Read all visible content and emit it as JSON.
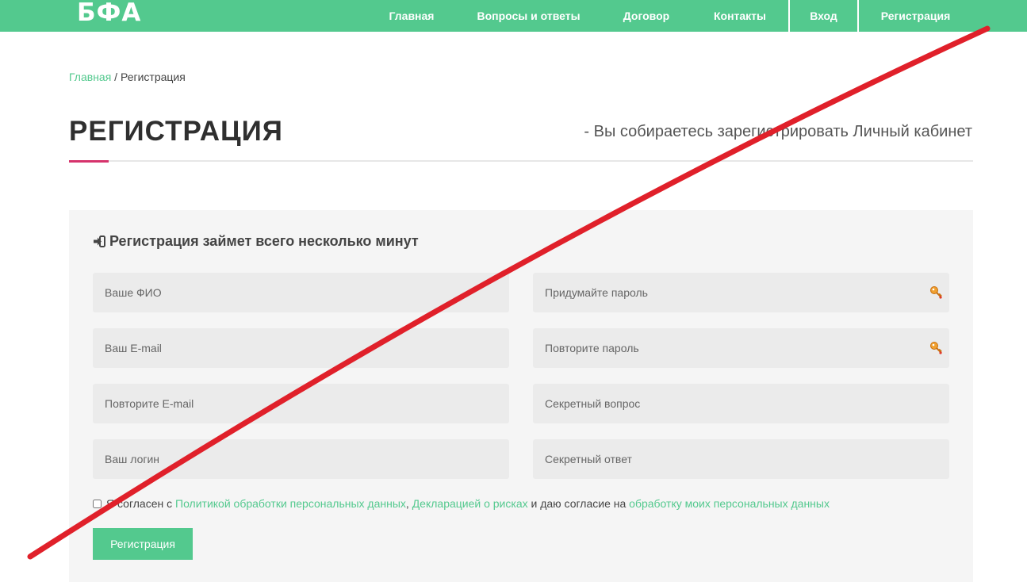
{
  "header": {
    "logo": "БФА",
    "nav": [
      {
        "label": "Главная"
      },
      {
        "label": "Вопросы и ответы"
      },
      {
        "label": "Договор"
      },
      {
        "label": "Контакты"
      },
      {
        "label": "Вход"
      },
      {
        "label": "Регистрация"
      }
    ],
    "background": "#53c98e"
  },
  "breadcrumb": {
    "home": "Главная",
    "separator": " / ",
    "current": "Регистрация"
  },
  "page": {
    "title": "РЕГИСТРАЦИЯ",
    "subtitle": "- Вы собираетесь зарегистрировать Личный кабинет",
    "accent_color": "#d6336c"
  },
  "form": {
    "heading": "Регистрация займет всего несколько минут",
    "fields": {
      "full_name": "Ваше ФИО",
      "email": "Ваш E-mail",
      "email_repeat": "Повторите E-mail",
      "login": "Ваш логин",
      "password": "Придумайте пароль",
      "password_repeat": "Повторите пароль",
      "secret_question": "Секретный вопрос",
      "secret_answer": "Секретный ответ"
    },
    "consent": {
      "prefix": "Я согласен с ",
      "link_policy": "Политикой обработки персональных данных",
      "comma": ", ",
      "link_risks": "Декларацией о рисках",
      "middle": " и даю согласие на ",
      "link_processing": "обработку моих персональных данных"
    },
    "submit_label": "Регистрация",
    "field_icon": "key-icon"
  },
  "overlay": {
    "strike_color": "#e0202a"
  }
}
